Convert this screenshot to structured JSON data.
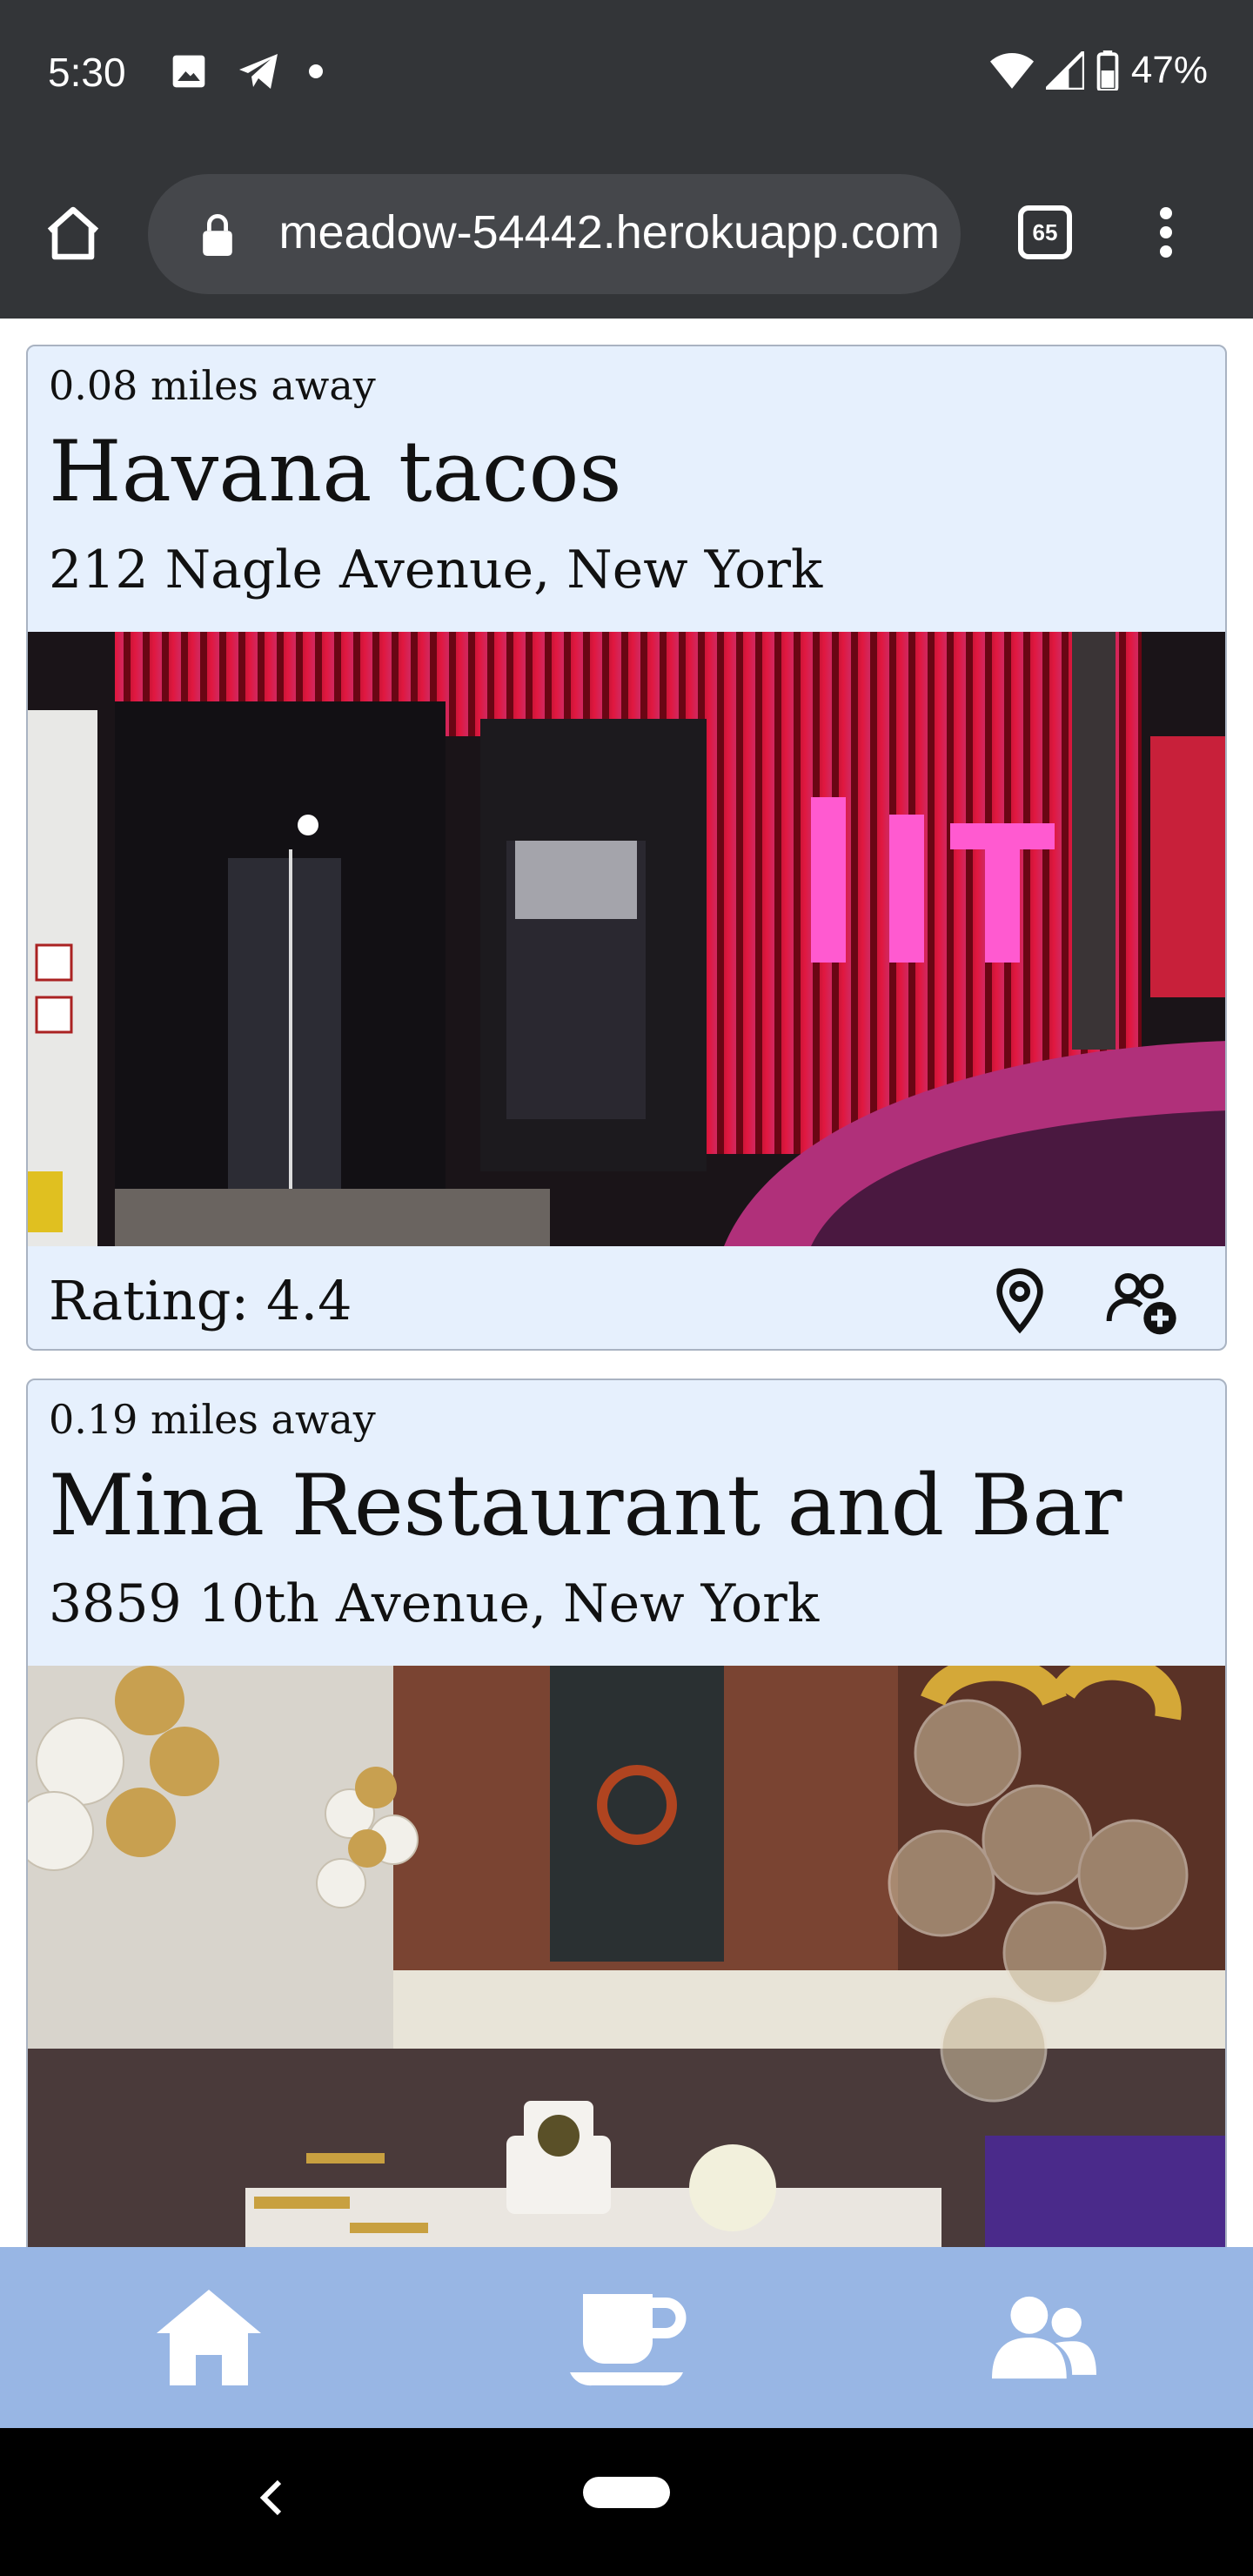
{
  "status_bar": {
    "time": "5:30",
    "battery_percent": "47%",
    "left_icons": [
      "image-icon",
      "telegram-icon",
      "dot-icon"
    ],
    "right_icons": [
      "wifi-icon",
      "signal-icon",
      "battery-icon"
    ]
  },
  "browser": {
    "url": "meadow-54442.herokuapp.com",
    "tab_count": "65"
  },
  "restaurants": [
    {
      "distance": "0.08 miles away",
      "name": "Havana tacos",
      "address": "212 Nagle Avenue, New York",
      "rating": "Rating: 4.4",
      "image_desc_icon": "photo-storefront"
    },
    {
      "distance": "0.19 miles away",
      "name": "Mina Restaurant and Bar",
      "address": "3859 10th Avenue, New York",
      "image_desc_icon": "photo-dining-room"
    }
  ],
  "bottom_nav": {
    "items": [
      "home-icon",
      "coffee-cup-icon",
      "users-icon"
    ]
  },
  "colors": {
    "card_bg": "#e6f0fd",
    "nav_bg": "#98b6e4",
    "status_bg": "#333538"
  }
}
